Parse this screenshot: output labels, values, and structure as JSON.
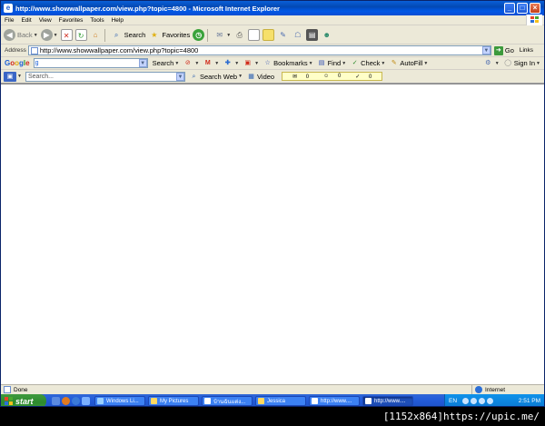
{
  "window": {
    "title": "http://www.showwallpaper.com/view.php?topic=4800 - Microsoft Internet Explorer",
    "minimize": "_",
    "maximize": "□",
    "close": "×"
  },
  "menu": [
    "File",
    "Edit",
    "View",
    "Favorites",
    "Tools",
    "Help"
  ],
  "toolbar": {
    "back_label": "Back",
    "search_label": "Search",
    "favorites_label": "Favorites"
  },
  "address": {
    "label": "Address",
    "url": "http://www.showwallpaper.com/view.php?topic=4800",
    "go_label": "Go",
    "links_label": "Links"
  },
  "google_bar": {
    "logo": [
      "G",
      "o",
      "o",
      "g",
      "l",
      "e"
    ],
    "search_label": "Search",
    "bookmarks_label": "Bookmarks",
    "find_label": "Find",
    "check_label": "Check",
    "autofill_label": "AutoFill",
    "signin_label": "Sign In"
  },
  "search_bar": {
    "placeholder": "Search...",
    "search_web_label": "Search Web",
    "video_label": "Video",
    "counters": [
      "0",
      "0",
      "0"
    ]
  },
  "status": {
    "text": "Done",
    "zone": "Internet"
  },
  "taskbar": {
    "start_label": "start",
    "tasks": [
      {
        "label": "Windows Li..."
      },
      {
        "label": "My Pictures"
      },
      {
        "label": "บ้านฉันแต่ง..."
      },
      {
        "label": "Jessica"
      },
      {
        "label": "http://www...."
      },
      {
        "label": "http://www....",
        "active": true
      }
    ],
    "lang": "EN",
    "clock": "2:51 PM"
  },
  "watermark": "[1152x864]https://upic.me/",
  "colors": {
    "titlebar": "#0a5fd8",
    "start_button": "#3f9b3f",
    "taskbar": "#245edb",
    "tray": "#0f92ea"
  }
}
